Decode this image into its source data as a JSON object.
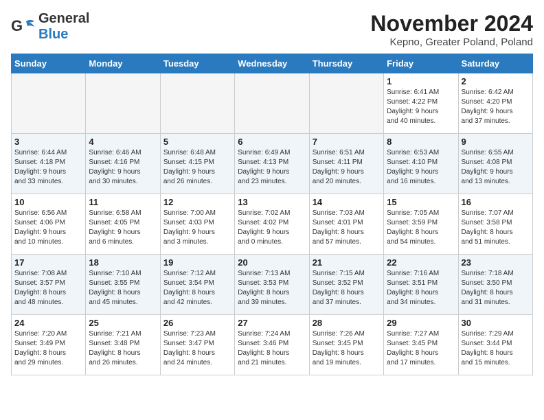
{
  "header": {
    "logo_general": "General",
    "logo_blue": "Blue",
    "month_title": "November 2024",
    "location": "Kepno, Greater Poland, Poland"
  },
  "days_of_week": [
    "Sunday",
    "Monday",
    "Tuesday",
    "Wednesday",
    "Thursday",
    "Friday",
    "Saturday"
  ],
  "weeks": [
    {
      "stripe": false,
      "days": [
        {
          "num": "",
          "info": ""
        },
        {
          "num": "",
          "info": ""
        },
        {
          "num": "",
          "info": ""
        },
        {
          "num": "",
          "info": ""
        },
        {
          "num": "",
          "info": ""
        },
        {
          "num": "1",
          "info": "Sunrise: 6:41 AM\nSunset: 4:22 PM\nDaylight: 9 hours\nand 40 minutes."
        },
        {
          "num": "2",
          "info": "Sunrise: 6:42 AM\nSunset: 4:20 PM\nDaylight: 9 hours\nand 37 minutes."
        }
      ]
    },
    {
      "stripe": true,
      "days": [
        {
          "num": "3",
          "info": "Sunrise: 6:44 AM\nSunset: 4:18 PM\nDaylight: 9 hours\nand 33 minutes."
        },
        {
          "num": "4",
          "info": "Sunrise: 6:46 AM\nSunset: 4:16 PM\nDaylight: 9 hours\nand 30 minutes."
        },
        {
          "num": "5",
          "info": "Sunrise: 6:48 AM\nSunset: 4:15 PM\nDaylight: 9 hours\nand 26 minutes."
        },
        {
          "num": "6",
          "info": "Sunrise: 6:49 AM\nSunset: 4:13 PM\nDaylight: 9 hours\nand 23 minutes."
        },
        {
          "num": "7",
          "info": "Sunrise: 6:51 AM\nSunset: 4:11 PM\nDaylight: 9 hours\nand 20 minutes."
        },
        {
          "num": "8",
          "info": "Sunrise: 6:53 AM\nSunset: 4:10 PM\nDaylight: 9 hours\nand 16 minutes."
        },
        {
          "num": "9",
          "info": "Sunrise: 6:55 AM\nSunset: 4:08 PM\nDaylight: 9 hours\nand 13 minutes."
        }
      ]
    },
    {
      "stripe": false,
      "days": [
        {
          "num": "10",
          "info": "Sunrise: 6:56 AM\nSunset: 4:06 PM\nDaylight: 9 hours\nand 10 minutes."
        },
        {
          "num": "11",
          "info": "Sunrise: 6:58 AM\nSunset: 4:05 PM\nDaylight: 9 hours\nand 6 minutes."
        },
        {
          "num": "12",
          "info": "Sunrise: 7:00 AM\nSunset: 4:03 PM\nDaylight: 9 hours\nand 3 minutes."
        },
        {
          "num": "13",
          "info": "Sunrise: 7:02 AM\nSunset: 4:02 PM\nDaylight: 9 hours\nand 0 minutes."
        },
        {
          "num": "14",
          "info": "Sunrise: 7:03 AM\nSunset: 4:01 PM\nDaylight: 8 hours\nand 57 minutes."
        },
        {
          "num": "15",
          "info": "Sunrise: 7:05 AM\nSunset: 3:59 PM\nDaylight: 8 hours\nand 54 minutes."
        },
        {
          "num": "16",
          "info": "Sunrise: 7:07 AM\nSunset: 3:58 PM\nDaylight: 8 hours\nand 51 minutes."
        }
      ]
    },
    {
      "stripe": true,
      "days": [
        {
          "num": "17",
          "info": "Sunrise: 7:08 AM\nSunset: 3:57 PM\nDaylight: 8 hours\nand 48 minutes."
        },
        {
          "num": "18",
          "info": "Sunrise: 7:10 AM\nSunset: 3:55 PM\nDaylight: 8 hours\nand 45 minutes."
        },
        {
          "num": "19",
          "info": "Sunrise: 7:12 AM\nSunset: 3:54 PM\nDaylight: 8 hours\nand 42 minutes."
        },
        {
          "num": "20",
          "info": "Sunrise: 7:13 AM\nSunset: 3:53 PM\nDaylight: 8 hours\nand 39 minutes."
        },
        {
          "num": "21",
          "info": "Sunrise: 7:15 AM\nSunset: 3:52 PM\nDaylight: 8 hours\nand 37 minutes."
        },
        {
          "num": "22",
          "info": "Sunrise: 7:16 AM\nSunset: 3:51 PM\nDaylight: 8 hours\nand 34 minutes."
        },
        {
          "num": "23",
          "info": "Sunrise: 7:18 AM\nSunset: 3:50 PM\nDaylight: 8 hours\nand 31 minutes."
        }
      ]
    },
    {
      "stripe": false,
      "days": [
        {
          "num": "24",
          "info": "Sunrise: 7:20 AM\nSunset: 3:49 PM\nDaylight: 8 hours\nand 29 minutes."
        },
        {
          "num": "25",
          "info": "Sunrise: 7:21 AM\nSunset: 3:48 PM\nDaylight: 8 hours\nand 26 minutes."
        },
        {
          "num": "26",
          "info": "Sunrise: 7:23 AM\nSunset: 3:47 PM\nDaylight: 8 hours\nand 24 minutes."
        },
        {
          "num": "27",
          "info": "Sunrise: 7:24 AM\nSunset: 3:46 PM\nDaylight: 8 hours\nand 21 minutes."
        },
        {
          "num": "28",
          "info": "Sunrise: 7:26 AM\nSunset: 3:45 PM\nDaylight: 8 hours\nand 19 minutes."
        },
        {
          "num": "29",
          "info": "Sunrise: 7:27 AM\nSunset: 3:45 PM\nDaylight: 8 hours\nand 17 minutes."
        },
        {
          "num": "30",
          "info": "Sunrise: 7:29 AM\nSunset: 3:44 PM\nDaylight: 8 hours\nand 15 minutes."
        }
      ]
    }
  ]
}
